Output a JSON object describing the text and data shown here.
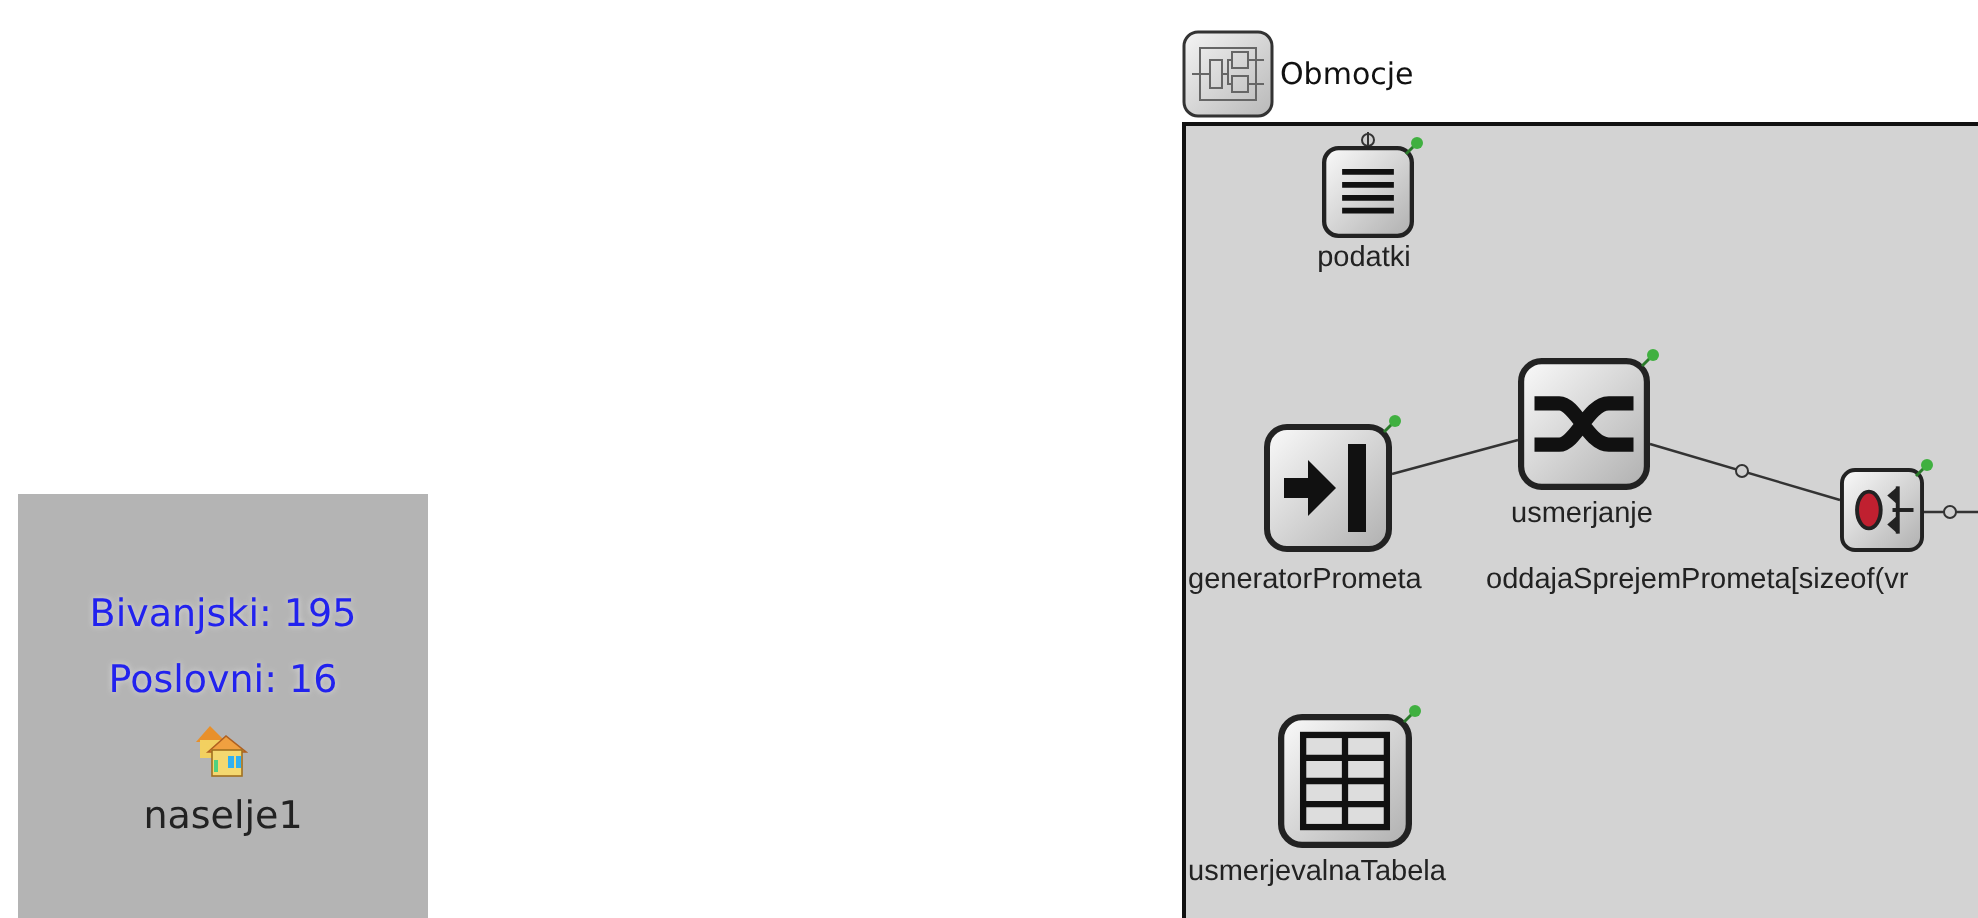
{
  "left_module": {
    "stats": [
      "Bivanjski: 195",
      "Poslovni: 16"
    ],
    "name": "naselje1"
  },
  "compound_module": {
    "name": "Obmocje",
    "submodules": [
      {
        "name": "podatki",
        "kind": "list"
      },
      {
        "name": "usmerjanje",
        "kind": "router"
      },
      {
        "name": "generatorPrometa",
        "kind": "source"
      },
      {
        "name": "oddajaSprejemPrometa[sizeof(vr",
        "kind": "transceiver"
      },
      {
        "name": "usmerjevalnaTabela",
        "kind": "table"
      }
    ]
  }
}
